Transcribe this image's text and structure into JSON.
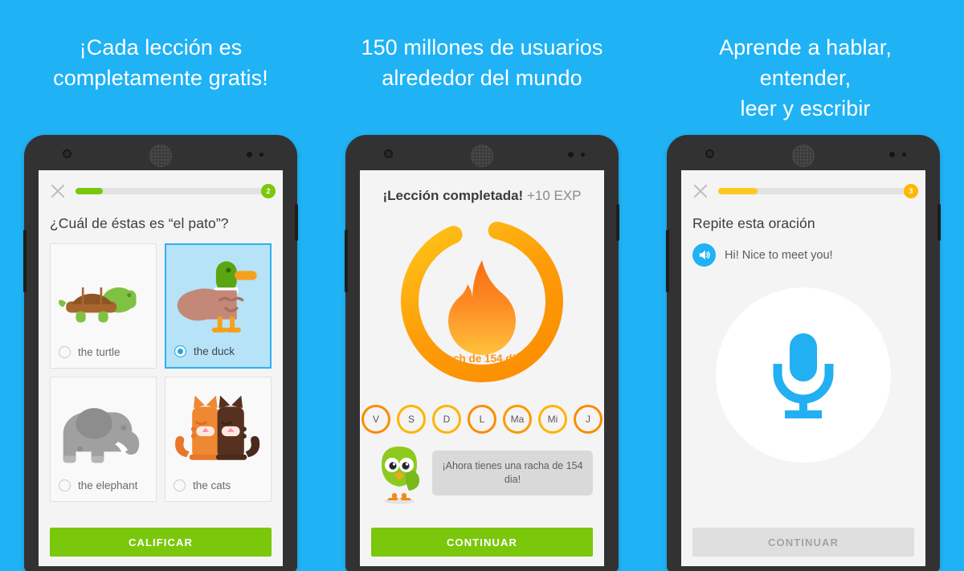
{
  "background_color": "#1fb2f5",
  "headlines": [
    {
      "line1": "¡Cada lección es",
      "line2": "completamente gratis!"
    },
    {
      "line1": "150 millones de usuarios",
      "line2": "alrededor del mundo"
    },
    {
      "line1": "Aprende a hablar, entender,",
      "line2": "leer y escribir"
    }
  ],
  "screen1": {
    "close_icon": "close-icon",
    "progress": {
      "value": 2,
      "badge_label": "2",
      "percent": 14,
      "fill_color": "#7ac70c",
      "badge_color": "#7ac70c"
    },
    "prompt": "¿Cuál de éstas es “el pato”?",
    "choices": [
      {
        "label": "the turtle",
        "icon": "turtle-illustration",
        "selected": false
      },
      {
        "label": "the duck",
        "icon": "duck-illustration",
        "selected": true
      },
      {
        "label": "the elephant",
        "icon": "elephant-illustration",
        "selected": false
      },
      {
        "label": "the cats",
        "icon": "cats-illustration",
        "selected": false
      }
    ],
    "cta": {
      "label": "CALIFICAR",
      "enabled": true,
      "color": "#7ac70c"
    }
  },
  "screen2": {
    "title_bold": "¡Lección completada!",
    "title_rest": " +10 EXP",
    "ring": {
      "streak_text": "rach de 154 día",
      "progress_percent": 88,
      "color_start": "#fb8c00",
      "color_end": "#ffc107"
    },
    "flame_icon": "flame-icon",
    "days": [
      {
        "label": "V",
        "complete": true
      },
      {
        "label": "S",
        "complete": false
      },
      {
        "label": "D",
        "complete": false
      },
      {
        "label": "L",
        "complete": true
      },
      {
        "label": "Ma",
        "complete": true
      },
      {
        "label": "Mi",
        "complete": false
      },
      {
        "label": "J",
        "complete": true
      }
    ],
    "owl_icon": "duo-owl-mascot",
    "bubble_text": "¡Ahora tienes una racha de 154 dia!",
    "cta": {
      "label": "CONTINUAR",
      "enabled": true,
      "color": "#7ac70c"
    }
  },
  "screen3": {
    "close_icon": "close-icon",
    "progress": {
      "value": 3,
      "badge_label": "3",
      "percent": 20,
      "fill_color": "#ffc820",
      "badge_color": "#ffb800"
    },
    "prompt": "Repite esta oración",
    "speaker_icon": "speaker-icon",
    "sentence": "Hi! Nice to meet you!",
    "mic_icon": "microphone-icon",
    "cta": {
      "label": "CONTINUAR",
      "enabled": false,
      "color": "#dfdfdf"
    }
  }
}
